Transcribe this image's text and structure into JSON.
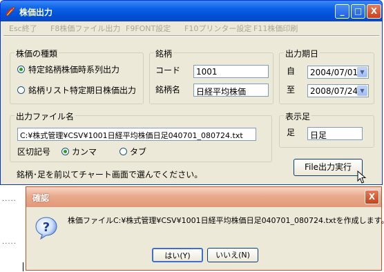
{
  "window": {
    "title": "株価出力",
    "buttons": {
      "minimize": "_",
      "maximize": "□",
      "close": "X"
    }
  },
  "menu": [
    "Esc終了",
    "F8株価ファイル出力",
    "F9FONT設定",
    "F10プリンター設定",
    "F11株価印刷"
  ],
  "kind_group": {
    "legend": "株価の種類",
    "option1": "特定銘柄株価時系列出力",
    "option2": "銘柄リスト特定期日株価出力"
  },
  "brand_group": {
    "legend": "銘柄",
    "code_label": "コード",
    "code_value": "1001",
    "name_label": "銘柄名",
    "name_value": "日経平均株価"
  },
  "period_group": {
    "legend": "出力期日",
    "from_label": "自",
    "from_value": "2004/07/01",
    "to_label": "至",
    "to_value": "2008/07/24"
  },
  "file_group": {
    "legend": "出力ファイル名",
    "path": "C:¥株式管理¥CSV¥1001日経平均株価日足040701_080724.txt",
    "delim_label": "区切記号",
    "delim_comma": "カンマ",
    "delim_tab": "タブ"
  },
  "display_group": {
    "legend": "表示足",
    "label": "足",
    "value": "日足"
  },
  "hint": "銘柄･足を前以てチャート画面で選んでください。",
  "run_button": "File出力実行",
  "dialog": {
    "title": "確認",
    "message": "株価ファイルC:¥株式管理¥CSV¥1001日経平均株価日足040701_080724.txtを作成します。",
    "yes": "はい(Y)",
    "no": "いいえ(N)"
  },
  "decor": {
    "dots": "....."
  }
}
